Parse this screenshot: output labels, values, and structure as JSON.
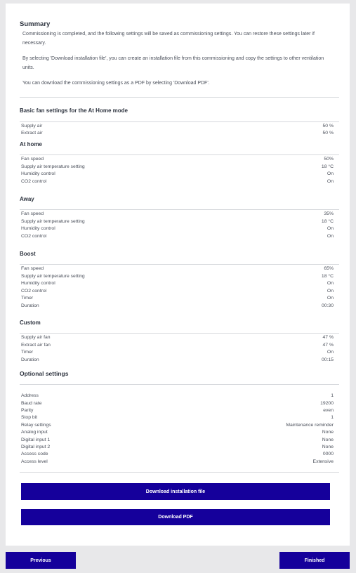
{
  "summary": {
    "title": "Summary",
    "p1": "Commissioning is completed, and the following settings will be saved as commissioning settings. You can restore these settings later if necessary.",
    "p2": "By selecting 'Download installation file', you can create an installation file from this commissioning and copy the settings to other ventilation units.",
    "p3": "You can download the commissioning settings as a PDF by selecting 'Download PDF'."
  },
  "basic": {
    "title": "Basic fan settings for the At Home mode",
    "rows": [
      {
        "label": "Supply air",
        "value": "50 %"
      },
      {
        "label": "Extract air",
        "value": "50 %"
      }
    ]
  },
  "at_home": {
    "title": "At home",
    "rows": [
      {
        "label": "Fan speed",
        "value": "50%"
      },
      {
        "label": "Supply air temperature setting",
        "value": "18 °C"
      },
      {
        "label": "Humidity control",
        "value": "On"
      },
      {
        "label": "CO2 control",
        "value": "On"
      }
    ]
  },
  "away": {
    "title": "Away",
    "rows": [
      {
        "label": "Fan speed",
        "value": "35%"
      },
      {
        "label": "Supply air temperature setting",
        "value": "18 °C"
      },
      {
        "label": "Humidity control",
        "value": "On"
      },
      {
        "label": "CO2 control",
        "value": "On"
      }
    ]
  },
  "boost": {
    "title": "Boost",
    "rows": [
      {
        "label": "Fan speed",
        "value": "65%"
      },
      {
        "label": "Supply air temperature setting",
        "value": "18 °C"
      },
      {
        "label": "Humidity control",
        "value": "On"
      },
      {
        "label": "CO2 control",
        "value": "On"
      },
      {
        "label": "Timer",
        "value": "On"
      },
      {
        "label": "Duration",
        "value": "00:30"
      }
    ]
  },
  "custom": {
    "title": "Custom",
    "rows": [
      {
        "label": "Supply air fan",
        "value": "47 %"
      },
      {
        "label": "Extract air fan",
        "value": "47 %"
      },
      {
        "label": "Timer",
        "value": "On"
      },
      {
        "label": "Duration",
        "value": "00:15"
      }
    ]
  },
  "optional": {
    "title": "Optional settings",
    "rows": [
      {
        "label": "Address",
        "value": "1"
      },
      {
        "label": "Baud rate",
        "value": "19200"
      },
      {
        "label": "Parity",
        "value": "even"
      },
      {
        "label": "Stop bit",
        "value": "1"
      },
      {
        "label": "Relay settings",
        "value": "Maintenance reminder"
      },
      {
        "label": "Analog input",
        "value": "None"
      },
      {
        "label": "Digital input 1",
        "value": "None"
      },
      {
        "label": "Digital input 2",
        "value": "None"
      },
      {
        "label": "Access code",
        "value": "0000"
      },
      {
        "label": "Access level",
        "value": "Extensive"
      }
    ]
  },
  "buttons": {
    "download_install": "Download installation file",
    "download_pdf": "Download PDF",
    "previous": "Previous",
    "finished": "Finished"
  },
  "colors": {
    "button": "#15009b",
    "divider": "#d6d8dc"
  }
}
